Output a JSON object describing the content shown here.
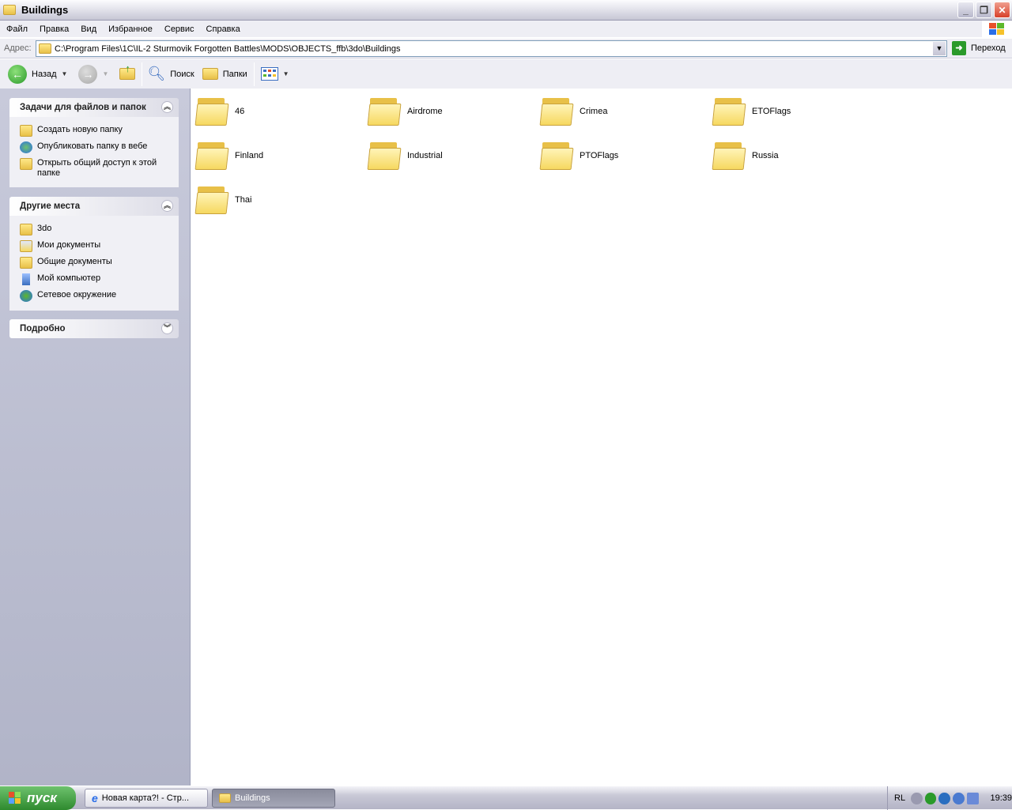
{
  "window": {
    "title": "Buildings"
  },
  "menu": [
    "Файл",
    "Правка",
    "Вид",
    "Избранное",
    "Сервис",
    "Справка"
  ],
  "address": {
    "label": "Адрес:",
    "path": "C:\\Program Files\\1C\\IL-2 Sturmovik Forgotten Battles\\MODS\\OBJECTS_ffb\\3do\\Buildings",
    "go_label": "Переход"
  },
  "toolbar": {
    "back": "Назад",
    "search": "Поиск",
    "folders": "Папки"
  },
  "tasks": {
    "title": "Задачи для файлов и папок",
    "items": [
      "Создать новую папку",
      "Опубликовать папку в вебе",
      "Открыть общий доступ к этой папке"
    ]
  },
  "places": {
    "title": "Другие места",
    "items": [
      "3do",
      "Мои документы",
      "Общие документы",
      "Мой компьютер",
      "Сетевое окружение"
    ]
  },
  "details": {
    "title": "Подробно"
  },
  "folders": [
    "46",
    "Airdrome",
    "Crimea",
    "ETOFlags",
    "Finland",
    "Industrial",
    "PTOFlags",
    "Russia",
    "Thai"
  ],
  "taskbar": {
    "start": "пуск",
    "buttons": [
      "Новая карта?! - Стр...",
      "Buildings"
    ],
    "lang": "RL",
    "clock": "19:39"
  }
}
